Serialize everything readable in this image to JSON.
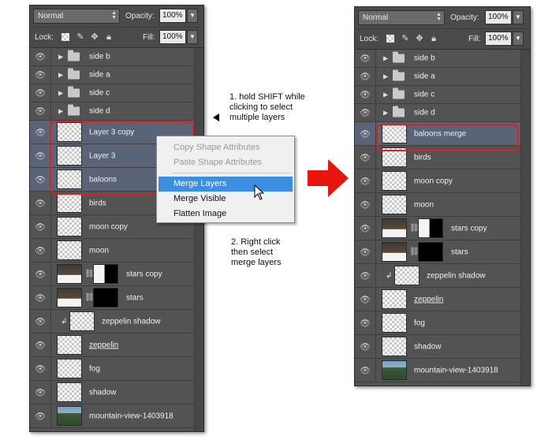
{
  "colors": {
    "panel": "#535353",
    "selected_row": "#5a6479",
    "highlight_red": "#e0211b",
    "menu_active": "#3c8fde",
    "arrow_red": "#e8150f"
  },
  "left_panel": {
    "blend_mode": "Normal",
    "opacity_label": "Opacity:",
    "opacity_value": "100%",
    "lock_label": "Lock:",
    "fill_label": "Fill:",
    "fill_value": "100%",
    "layers": [
      {
        "name": "side b",
        "kind": "group"
      },
      {
        "name": "side a",
        "kind": "group"
      },
      {
        "name": "side c",
        "kind": "group"
      },
      {
        "name": "side d",
        "kind": "group"
      },
      {
        "name": "Layer 3 copy",
        "kind": "layer",
        "selected": true
      },
      {
        "name": "Layer 3",
        "kind": "layer",
        "selected": true
      },
      {
        "name": "baloons",
        "kind": "layer",
        "selected": true
      },
      {
        "name": "birds",
        "kind": "layer"
      },
      {
        "name": "moon copy",
        "kind": "layer"
      },
      {
        "name": "moon",
        "kind": "layer"
      },
      {
        "name": "stars copy",
        "kind": "masked"
      },
      {
        "name": "stars",
        "kind": "masked"
      },
      {
        "name": "zeppelin shadow",
        "kind": "clipped"
      },
      {
        "name": "zeppelin",
        "kind": "layer",
        "underline": true
      },
      {
        "name": "fog",
        "kind": "layer"
      },
      {
        "name": "shadow",
        "kind": "layer"
      },
      {
        "name": "mountain-view-1403918",
        "kind": "image"
      }
    ]
  },
  "context_menu": {
    "items": [
      {
        "label": "Copy Shape Attributes",
        "state": "disabled"
      },
      {
        "label": "Paste Shape Attributes",
        "state": "disabled"
      },
      {
        "label": "Merge Layers",
        "state": "active"
      },
      {
        "label": "Merge Visible",
        "state": "normal"
      },
      {
        "label": "Flatten Image",
        "state": "normal"
      }
    ]
  },
  "annotations": {
    "step1": [
      "1. hold SHIFT while",
      "clicking to select",
      "multiple layers"
    ],
    "step2": [
      "2. Right click",
      "then select",
      "merge layers"
    ]
  },
  "right_panel": {
    "blend_mode": "Normal",
    "opacity_label": "Opacity:",
    "opacity_value": "100%",
    "lock_label": "Lock:",
    "fill_label": "Fill:",
    "fill_value": "100%",
    "layers": [
      {
        "name": "side b",
        "kind": "group"
      },
      {
        "name": "side a",
        "kind": "group"
      },
      {
        "name": "side c",
        "kind": "group"
      },
      {
        "name": "side d",
        "kind": "group"
      },
      {
        "name": "baloons merge",
        "kind": "layer",
        "selected": true
      },
      {
        "name": "birds",
        "kind": "layer"
      },
      {
        "name": "moon copy",
        "kind": "layer"
      },
      {
        "name": "moon",
        "kind": "layer"
      },
      {
        "name": "stars copy",
        "kind": "masked"
      },
      {
        "name": "stars",
        "kind": "masked"
      },
      {
        "name": "zeppelin shadow",
        "kind": "clipped"
      },
      {
        "name": "zeppelin",
        "kind": "layer",
        "underline": true
      },
      {
        "name": "fog",
        "kind": "layer"
      },
      {
        "name": "shadow",
        "kind": "layer"
      },
      {
        "name": "mountain-view-1403918",
        "kind": "image"
      }
    ]
  }
}
